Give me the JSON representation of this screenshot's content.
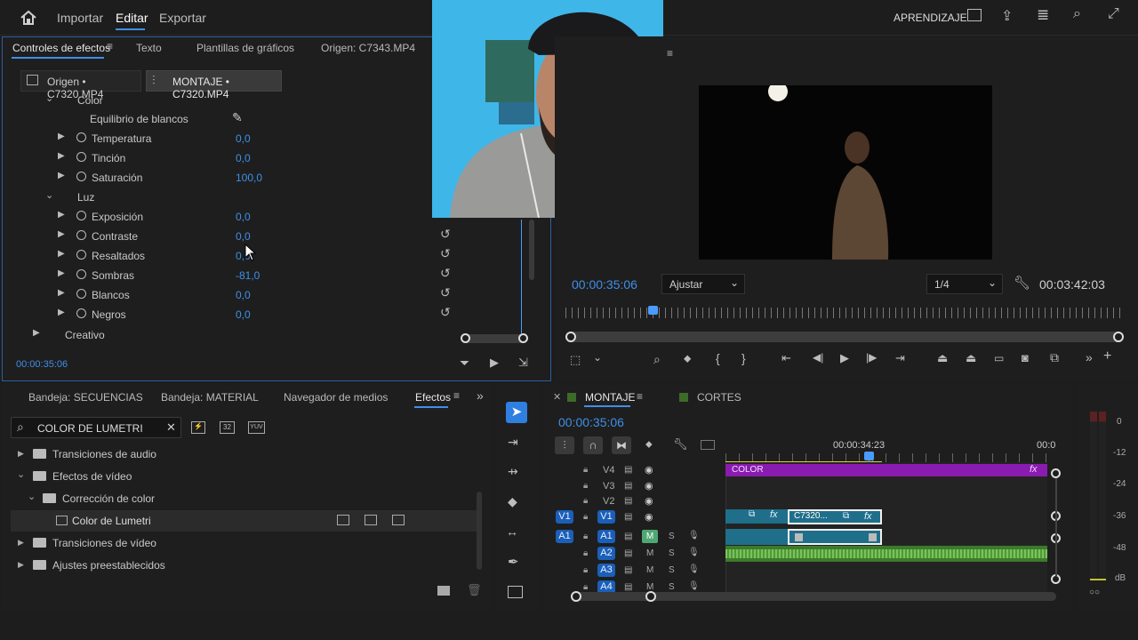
{
  "menu": {
    "home_icon": "home-icon",
    "items": [
      "Importar",
      "Editar",
      "Exportar"
    ],
    "active": "Editar",
    "right_label": "APRENDIZAJE"
  },
  "effect_controls": {
    "tabs": [
      "Controles de efectos",
      "Texto",
      "Plantillas de gráficos",
      "Origen: C7343.MP4"
    ],
    "source_tab": "Origen • C7320.MP4",
    "sequence_tab": "MONTAJE • C7320.MP4",
    "groups": [
      {
        "label": "Color"
      },
      {
        "label": "Luz"
      },
      {
        "label": "Creativo"
      }
    ],
    "white_balance": "Equilibrio de blancos",
    "color_params": [
      {
        "label": "Temperatura",
        "value": "0,0"
      },
      {
        "label": "Tinción",
        "value": "0,0"
      },
      {
        "label": "Saturación",
        "value": "100,0"
      }
    ],
    "light_params": [
      {
        "label": "Exposición",
        "value": "0,0"
      },
      {
        "label": "Contraste",
        "value": "0,0"
      },
      {
        "label": "Resaltados",
        "value": "0,0"
      },
      {
        "label": "Sombras",
        "value": "-81,0"
      },
      {
        "label": "Blancos",
        "value": "0,0"
      },
      {
        "label": "Negros",
        "value": "0,0"
      }
    ],
    "timecode": "00:00:35:06"
  },
  "program": {
    "timecode": "00:00:35:06",
    "fit": "Ajustar",
    "resolution": "1/4",
    "duration": "00:03:42:03"
  },
  "project": {
    "tabs": [
      "Bandeja: SECUENCIAS",
      "Bandeja: MATERIAL",
      "Navegador de medios",
      "Efectos"
    ],
    "active_tab": "Efectos",
    "search_value": "COLOR DE LUMETRI",
    "tree": [
      {
        "label": "Transiciones de audio"
      },
      {
        "label": "Efectos de vídeo"
      },
      {
        "label": "Corrección de color"
      },
      {
        "label": "Color de Lumetri"
      },
      {
        "label": "Transiciones de vídeo"
      },
      {
        "label": "Ajustes preestablecidos"
      }
    ],
    "badges": [
      "32",
      "YUV"
    ]
  },
  "timeline": {
    "tabs": [
      "MONTAJE",
      "CORTES"
    ],
    "active_tab": "MONTAJE",
    "timecode": "00:00:35:06",
    "ruler_time": "00:00:34:23",
    "ruler_end": "00:0",
    "video_tracks": [
      "V4",
      "V3",
      "V2",
      "V1"
    ],
    "audio_tracks": [
      "A1",
      "A2",
      "A3",
      "A4"
    ],
    "source_v": "V1",
    "source_a": "A1",
    "adjustment_clip": "COLOR",
    "clip_name": "C7320...",
    "fx": "fx",
    "m": "M",
    "s": "S"
  },
  "meter": {
    "labels": [
      "0",
      "-12",
      "-24",
      "-36",
      "-48",
      "dB"
    ]
  },
  "colors": {
    "accent": "#3f8fe8",
    "adjust_clip": "#8a1bb0",
    "video_clip": "#1f6f8b",
    "audio_wave": "#5aa040",
    "playhead": "#4a9bff"
  }
}
